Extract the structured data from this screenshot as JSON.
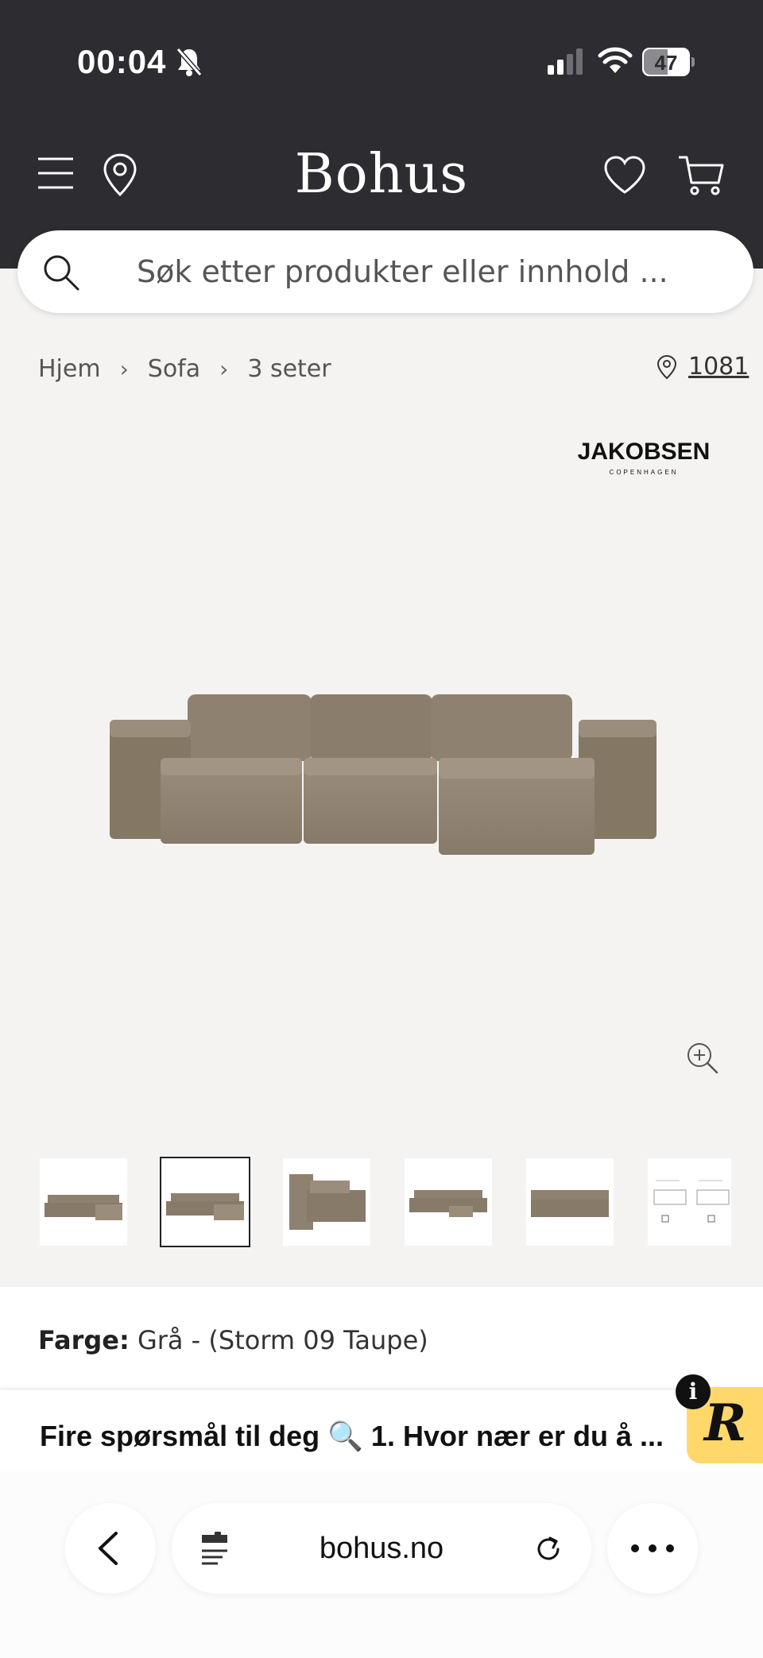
{
  "status_bar": {
    "time": "00:04",
    "battery": "47"
  },
  "header": {
    "logo": "Bohus"
  },
  "search": {
    "placeholder": "Søk etter produkter eller innhold ..."
  },
  "breadcrumb": {
    "items": [
      "Hjem",
      "Sofa",
      "3 seter"
    ]
  },
  "store": {
    "value": "1081"
  },
  "brand": {
    "name": "JAKOBSEN",
    "sub": "COPENHAGEN"
  },
  "product": {
    "color_label": "Farge:",
    "color_value": "Grå - (Storm 09 Taupe)"
  },
  "questions_banner": {
    "text": "Fire spørsmål til deg 🔍 1. Hvor nær er du å ..."
  },
  "badge": {
    "letter": "R",
    "info": "i"
  },
  "browser": {
    "url": "bohus.no"
  },
  "colors": {
    "header_bg": "#2c2c31",
    "page_bg": "#f4f3f1",
    "sofa": "#8e8170",
    "badge": "#ffd76a"
  }
}
